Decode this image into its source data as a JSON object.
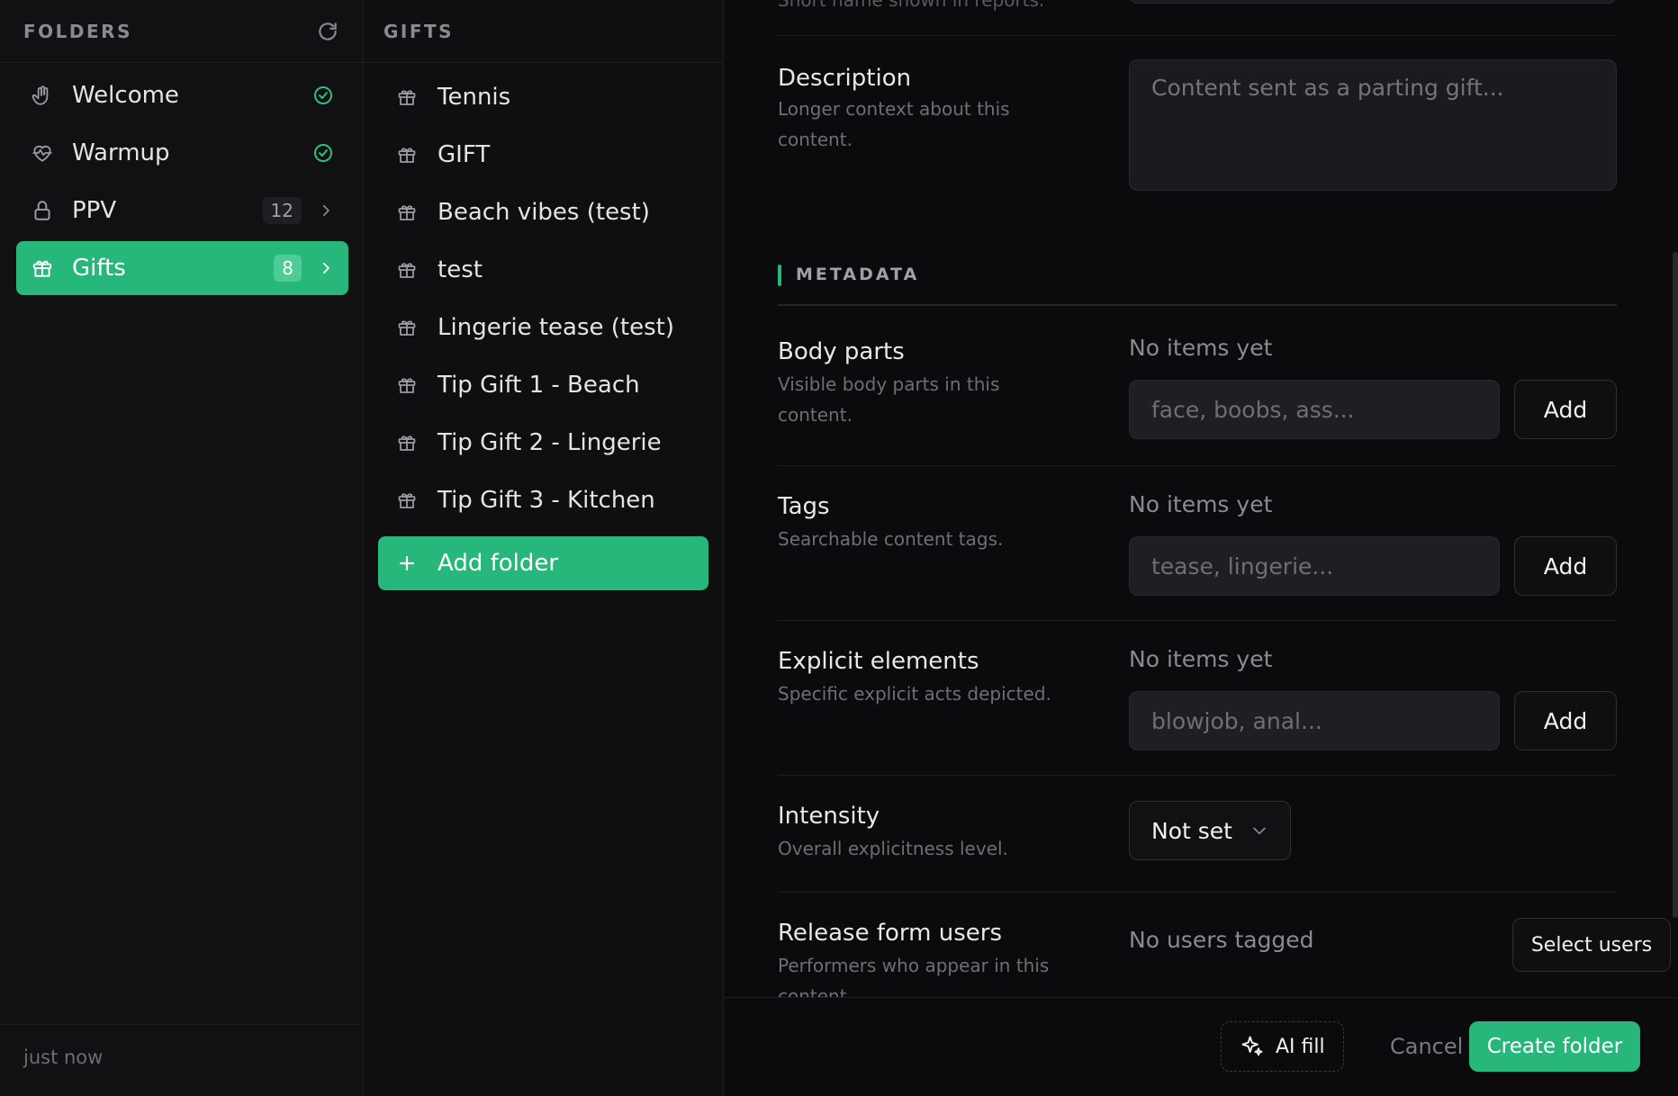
{
  "folders": {
    "header": "FOLDERS",
    "items": [
      {
        "label": "Welcome",
        "icon": "hand-icon",
        "status": "done"
      },
      {
        "label": "Warmup",
        "icon": "heart-pulse-icon",
        "status": "done"
      },
      {
        "label": "PPV",
        "icon": "lock-icon",
        "count": "12"
      },
      {
        "label": "Gifts",
        "icon": "gift-icon",
        "count": "8",
        "active": true
      }
    ],
    "footer": "just now"
  },
  "gifts": {
    "header": "GIFTS",
    "items": [
      {
        "label": "Tennis"
      },
      {
        "label": "GIFT"
      },
      {
        "label": "Beach vibes (test)"
      },
      {
        "label": "test"
      },
      {
        "label": "Lingerie tease (test)"
      },
      {
        "label": "Tip Gift 1 - Beach"
      },
      {
        "label": "Tip Gift 2 - Lingerie"
      },
      {
        "label": "Tip Gift 3 - Kitchen"
      }
    ],
    "add_label": "Add folder"
  },
  "form": {
    "top_hint": "Short name shown in reports.",
    "description": {
      "label": "Description",
      "desc": "Longer context about this content.",
      "placeholder": "Content sent as a parting gift..."
    },
    "metadata_header": "METADATA",
    "body_parts": {
      "label": "Body parts",
      "desc": "Visible body parts in this content.",
      "empty": "No items yet",
      "placeholder": "face, boobs, ass...",
      "add": "Add"
    },
    "tags": {
      "label": "Tags",
      "desc": "Searchable content tags.",
      "empty": "No items yet",
      "placeholder": "tease, lingerie...",
      "add": "Add"
    },
    "explicit": {
      "label": "Explicit elements",
      "desc": "Specific explicit acts depicted.",
      "empty": "No items yet",
      "placeholder": "blowjob, anal...",
      "add": "Add"
    },
    "intensity": {
      "label": "Intensity",
      "desc": "Overall explicitness level.",
      "value": "Not set"
    },
    "release": {
      "label": "Release form users",
      "desc": "Performers who appear in this content.",
      "empty": "No users tagged",
      "button": "Select users"
    }
  },
  "footer": {
    "ai_fill": "AI fill",
    "cancel": "Cancel",
    "create": "Create folder"
  },
  "colors": {
    "accent": "#27b77a",
    "background": "#0b0b0d",
    "panel": "#111114"
  }
}
